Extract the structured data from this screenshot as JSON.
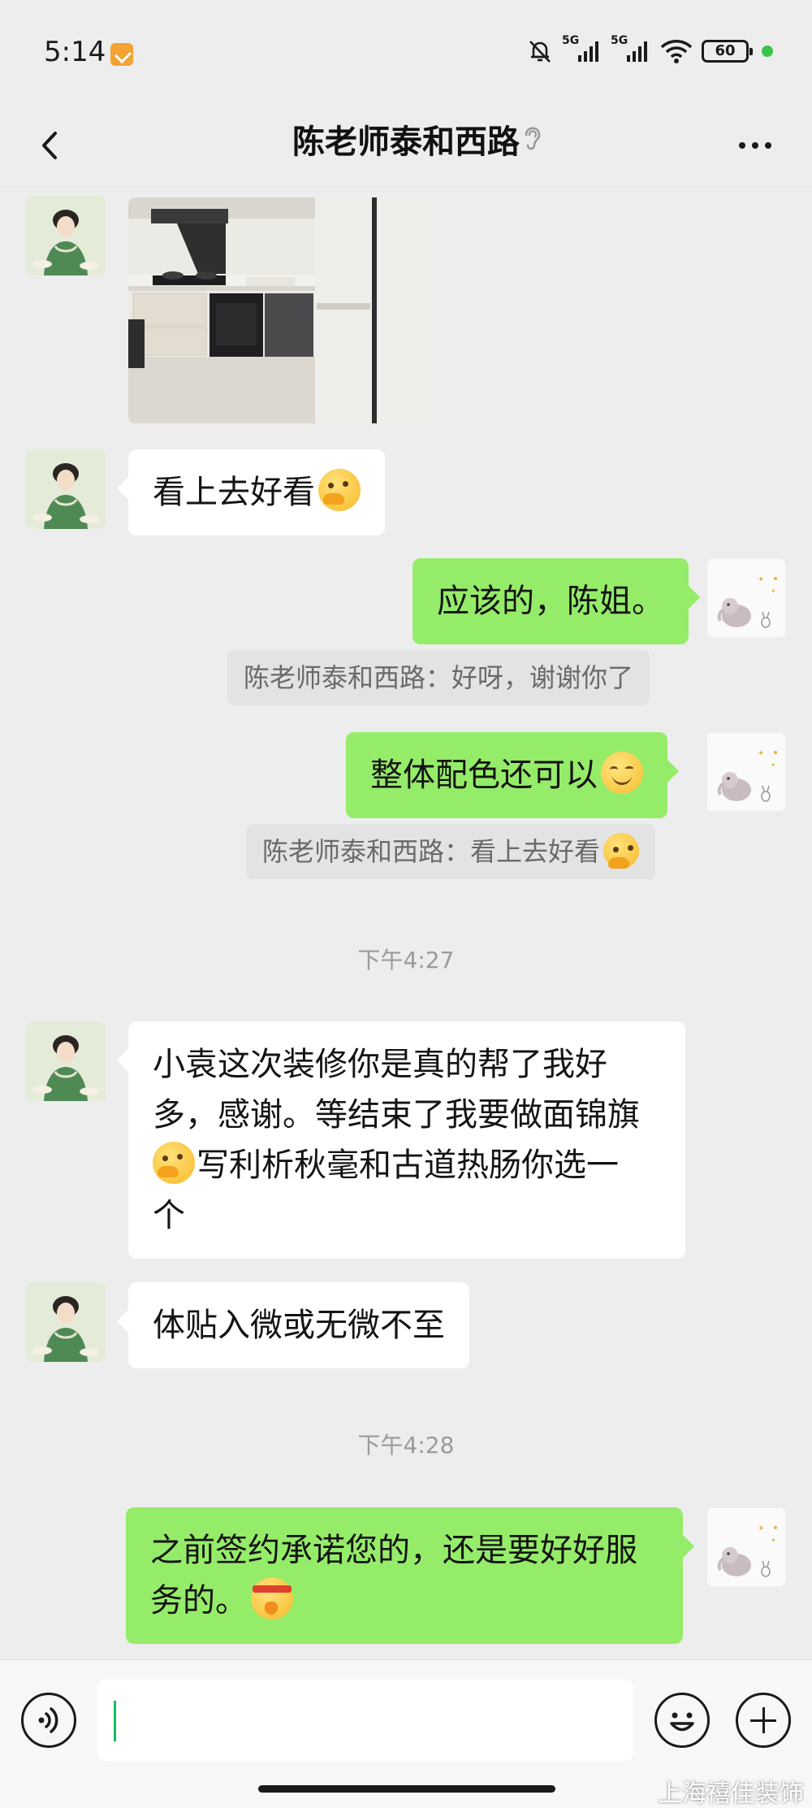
{
  "status_bar": {
    "time": "5:14",
    "signal1": "5G",
    "signal2": "5G",
    "battery": "60"
  },
  "header": {
    "title": "陈老师泰和西路"
  },
  "messages": {
    "m1_text": "看上去好看",
    "m2_text": "应该的，陈姐。",
    "m2_quote": "陈老师泰和西路：好呀，谢谢你了",
    "m3_text": "整体配色还可以",
    "m3_quote": "陈老师泰和西路：看上去好看",
    "time1": "下午4:27",
    "m4_line1": "小袁这次装修你是真的帮了我好",
    "m4_line2": "多，感谢。等结束了我要做面锦旗",
    "m4_line3": "写利析秋毫和古道热肠你选一",
    "m4_line4": "个",
    "m5_text": "体贴入微或无微不至",
    "time2": "下午4:28",
    "m6_line1": "之前签约承诺您的，还是要好好服",
    "m6_line2": "务的。"
  },
  "watermark": "上海禧佳装饰",
  "colors": {
    "background": "#ededed",
    "sent_bubble": "#95ec69",
    "received_bubble": "#ffffff",
    "accent": "#07c160"
  },
  "icons": [
    "back-icon",
    "ear-icon",
    "more-icon",
    "voice-icon",
    "emoji-icon",
    "plus-icon"
  ]
}
